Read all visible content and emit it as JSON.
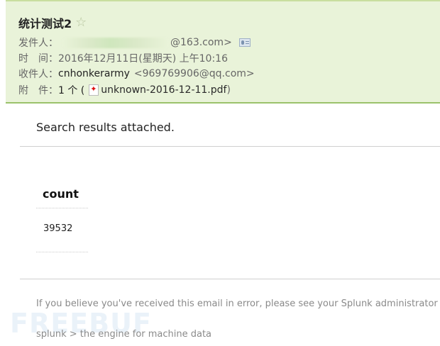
{
  "header": {
    "subject": "统计测试2",
    "sender_label": "发件人：",
    "sender_domain": "@163.com>",
    "time_label": "时　间：",
    "time_value": "2016年12月11日(星期天) 上午10:16",
    "recipient_label": "收件人：",
    "recipient_name": "cnhonkerarmy",
    "recipient_email": "<969769906@qq.com>",
    "attachment_label": "附　件：",
    "attachment_count": "1 个 (",
    "attachment_name": "unknown-2016-12-11.pdf",
    "attachment_close": ")"
  },
  "body": {
    "message": "Search results attached.",
    "table": {
      "header": "count",
      "rows": [
        "39532"
      ]
    },
    "footer_note": "If you believe you've received this email in error, please see your Splunk administrator",
    "footer_brand": "splunk > the engine for machine data",
    "watermark": "FREEBUF"
  },
  "icons": {
    "star": "star-outline-icon",
    "contact": "contact-card-icon",
    "pdf": "pdf-icon"
  },
  "colors": {
    "header_bg": "#e9f3d9",
    "header_border": "#9bc26b"
  }
}
